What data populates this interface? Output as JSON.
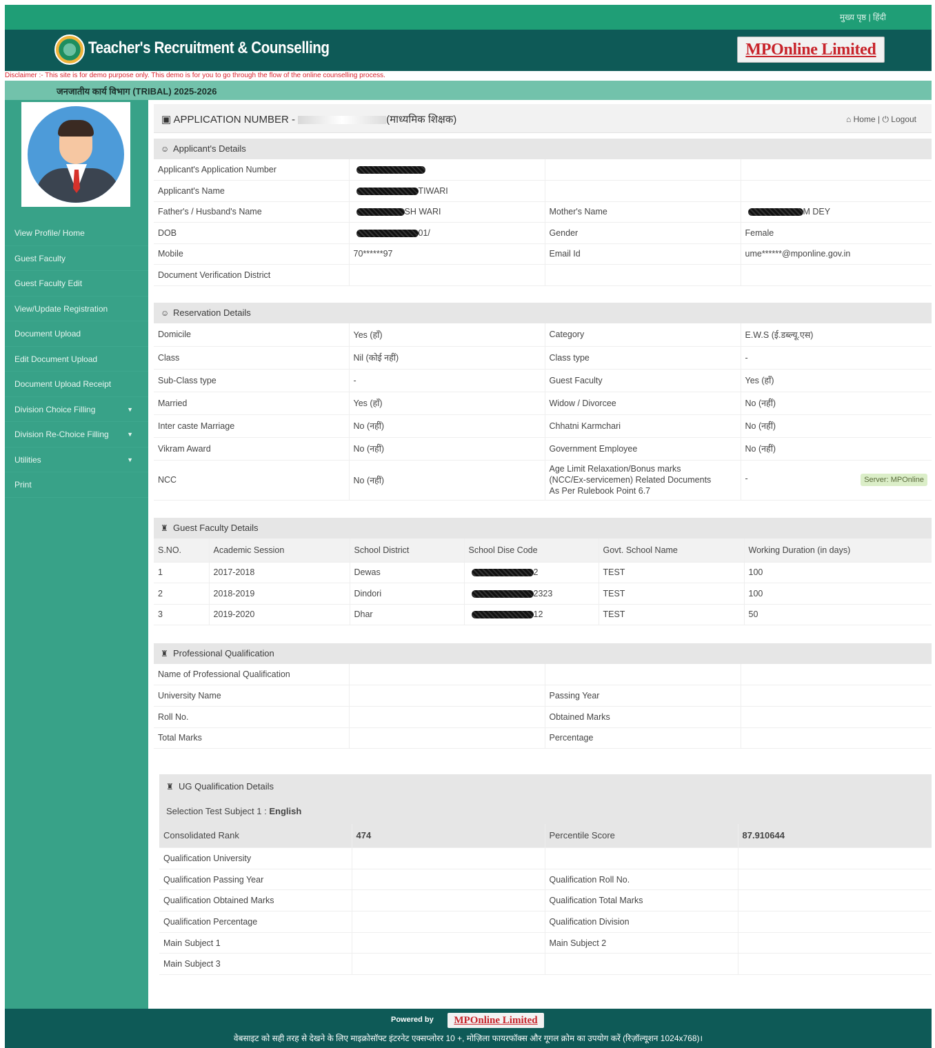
{
  "topbar": {
    "language_links": "मुख्य पृष्ठ | हिंदी"
  },
  "header": {
    "title": "Teacher's Recruitment & Counselling",
    "brand": "MPOnline Limited"
  },
  "disclaimer": "Disclaimer :- This site is for demo purpose only. This demo is for you to go through the flow of the online counselling process.",
  "department": "जनजातीय कार्य विभाग (TRIBAL) 2025-2026",
  "sidebar": {
    "items": [
      {
        "label": "View Profile/ Home",
        "caret": false
      },
      {
        "label": "Guest Faculty",
        "caret": false
      },
      {
        "label": "Guest Faculty Edit",
        "caret": false
      },
      {
        "label": "View/Update Registration",
        "caret": false
      },
      {
        "label": "Document Upload",
        "caret": false
      },
      {
        "label": "Edit Document Upload",
        "caret": false
      },
      {
        "label": "Document Upload Receipt",
        "caret": false
      },
      {
        "label": "Division Choice Filling",
        "caret": true
      },
      {
        "label": "Division Re-Choice Filling",
        "caret": true
      },
      {
        "label": "Utilities",
        "caret": true
      },
      {
        "label": "Print",
        "caret": false
      }
    ]
  },
  "apphead": {
    "label": "APPLICATION NUMBER - ",
    "suffix": "(माध्यमिक शिक्षक)",
    "home": "Home",
    "logout": "Logout"
  },
  "applicant": {
    "title": "Applicant's Details",
    "rows": [
      {
        "l1": "Applicant's Application Number",
        "v1": "",
        "l2": "",
        "v2": ""
      },
      {
        "l1": "Applicant's Name",
        "v1": "TIWARI",
        "l2": "",
        "v2": ""
      },
      {
        "l1": "Father's / Husband's Name",
        "v1": "SH WARI",
        "l2": "Mother's Name",
        "v2": "M DEY"
      },
      {
        "l1": "DOB",
        "v1": "01/",
        "l2": "Gender",
        "v2": "Female"
      },
      {
        "l1": "Mobile",
        "v1": "70******97",
        "l2": "Email Id",
        "v2": "ume******@mponline.gov.in"
      },
      {
        "l1": "Document Verification District",
        "v1": "",
        "l2": "",
        "v2": ""
      }
    ]
  },
  "reservation": {
    "title": "Reservation Details",
    "rows": [
      {
        "l1": "Domicile",
        "v1": "Yes (हाँ)",
        "l2": "Category",
        "v2": "E.W.S (ई.डब्ल्यू.एस)"
      },
      {
        "l1": "Class",
        "v1": "Nil (कोई नहीं)",
        "l2": "Class type",
        "v2": "-"
      },
      {
        "l1": "Sub-Class type",
        "v1": "-",
        "l2": "Guest Faculty",
        "v2": "Yes (हाँ)"
      },
      {
        "l1": "Married",
        "v1": "Yes (हाँ)",
        "l2": "Widow / Divorcee",
        "v2": "No (नहीं)"
      },
      {
        "l1": "Inter caste Marriage",
        "v1": "No (नहीं)",
        "l2": "Chhatni Karmchari",
        "v2": "No (नहीं)"
      },
      {
        "l1": "Vikram Award",
        "v1": "No (नहीं)",
        "l2": "Government Employee",
        "v2": "No (नहीं)"
      }
    ],
    "ncc": {
      "l1": "NCC",
      "v1": "No (नहीं)",
      "l2a": "Age Limit Relaxation/Bonus marks",
      "l2b": "(NCC/Ex-servicemen) Related Documents",
      "l2c": "As Per Rulebook Point 6.7",
      "v2": "-"
    },
    "server": "Server: MPOnline"
  },
  "guest": {
    "title": "Guest Faculty Details",
    "headers": [
      "S.NO.",
      "Academic Session",
      "School District",
      "School Dise Code",
      "Govt. School Name",
      "Working Duration (in days)"
    ],
    "rows": [
      {
        "sno": "1",
        "session": "2017-2018",
        "district": "Dewas",
        "code": "2",
        "school": "TEST",
        "days": "100"
      },
      {
        "sno": "2",
        "session": "2018-2019",
        "district": "Dindori",
        "code": "2323",
        "school": "TEST",
        "days": "100"
      },
      {
        "sno": "3",
        "session": "2019-2020",
        "district": "Dhar",
        "code": "12",
        "school": "TEST",
        "days": "50"
      }
    ]
  },
  "professional": {
    "title": "Professional Qualification",
    "rows": [
      {
        "l1": "Name of Professional Qualification",
        "v1": "",
        "l2": "",
        "v2": ""
      },
      {
        "l1": "University Name",
        "v1": "",
        "l2": "Passing Year",
        "v2": ""
      },
      {
        "l1": "Roll No.",
        "v1": "",
        "l2": "Obtained Marks",
        "v2": ""
      },
      {
        "l1": "Total Marks",
        "v1": "",
        "l2": "Percentage",
        "v2": ""
      }
    ]
  },
  "ug": {
    "title": "UG Qualification Details",
    "subject_label": "Selection Test Subject 1 : ",
    "subject_value": "English",
    "rank_label": "Consolidated Rank",
    "rank_value": "474",
    "score_label": "Percentile Score",
    "score_value": "87.910644",
    "rows": [
      {
        "l1": "Qualification University",
        "v1": "",
        "l2": "",
        "v2": ""
      },
      {
        "l1": "Qualification Passing Year",
        "v1": "",
        "l2": "Qualification Roll No.",
        "v2": ""
      },
      {
        "l1": "Qualification Obtained Marks",
        "v1": "",
        "l2": "Qualification Total Marks",
        "v2": ""
      },
      {
        "l1": "Qualification Percentage",
        "v1": "",
        "l2": "Qualification Division",
        "v2": ""
      },
      {
        "l1": "Main Subject 1",
        "v1": "",
        "l2": "Main Subject 2",
        "v2": ""
      },
      {
        "l1": "Main Subject 3",
        "v1": "",
        "l2": "",
        "v2": ""
      }
    ]
  },
  "footer": {
    "powered_by": "Powered by",
    "brand": "MPOnline Limited",
    "note": "वेबसाइट को सही तरह से देखने के लिए माइक्रोसॉफ्ट इंटरनेट एक्सप्लोरर 10 +, मोज़िला फायरफॉक्स और गूगल क्रोम का उपयोग करें (रिज़ॉल्यूशन 1024x768)।"
  }
}
